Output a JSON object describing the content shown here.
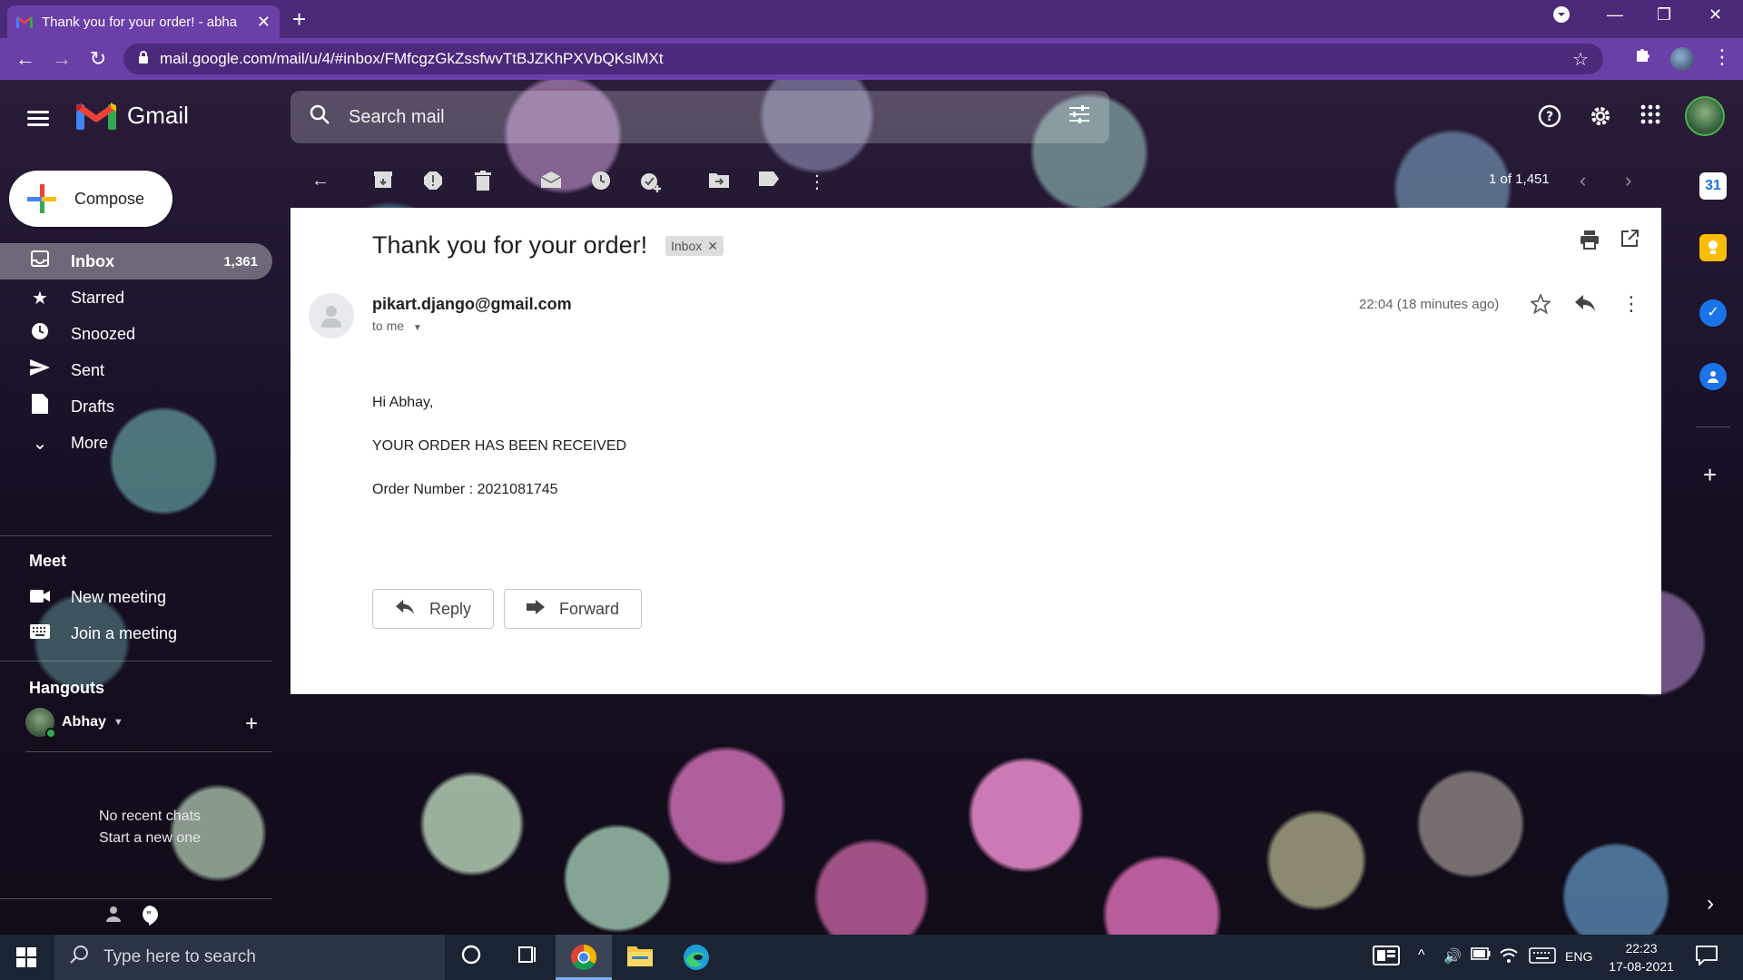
{
  "browser": {
    "tab_title": "Thank you for your order! - abha",
    "url": "mail.google.com/mail/u/4/#inbox/FMfcgzGkZssfwvTtBJZKhPXVbQKslMXt",
    "accent": "#6a3fa8"
  },
  "gmail": {
    "product_name": "Gmail",
    "search_placeholder": "Search mail",
    "compose_label": "Compose",
    "nav": [
      {
        "label": "Inbox",
        "count": "1,361",
        "icon": "inbox-icon"
      },
      {
        "label": "Starred",
        "count": "",
        "icon": "star-icon"
      },
      {
        "label": "Snoozed",
        "count": "",
        "icon": "clock-icon"
      },
      {
        "label": "Sent",
        "count": "",
        "icon": "send-icon"
      },
      {
        "label": "Drafts",
        "count": "",
        "icon": "draft-icon"
      },
      {
        "label": "More",
        "count": "",
        "icon": "chevron-down-icon"
      }
    ],
    "meet": {
      "title": "Meet",
      "new_meeting": "New meeting",
      "join_meeting": "Join a meeting"
    },
    "hangouts": {
      "title": "Hangouts",
      "user": "Abhay",
      "no_chats": "No recent chats",
      "start_new": "Start a new one"
    },
    "toolbar": {
      "counter": "1 of 1,451"
    }
  },
  "email": {
    "subject": "Thank you for your order!",
    "label": "Inbox",
    "sender": "pikart.django@gmail.com",
    "to": "to me",
    "timestamp": "22:04 (18 minutes ago)",
    "greeting": "Hi Abhay,",
    "line1": "YOUR ORDER HAS BEEN RECEIVED",
    "line2": "Order Number : 2021081745",
    "reply_label": "Reply",
    "forward_label": "Forward"
  },
  "taskbar": {
    "search_placeholder": "Type here to search",
    "language": "ENG",
    "time": "22:23",
    "date": "17-08-2021"
  }
}
